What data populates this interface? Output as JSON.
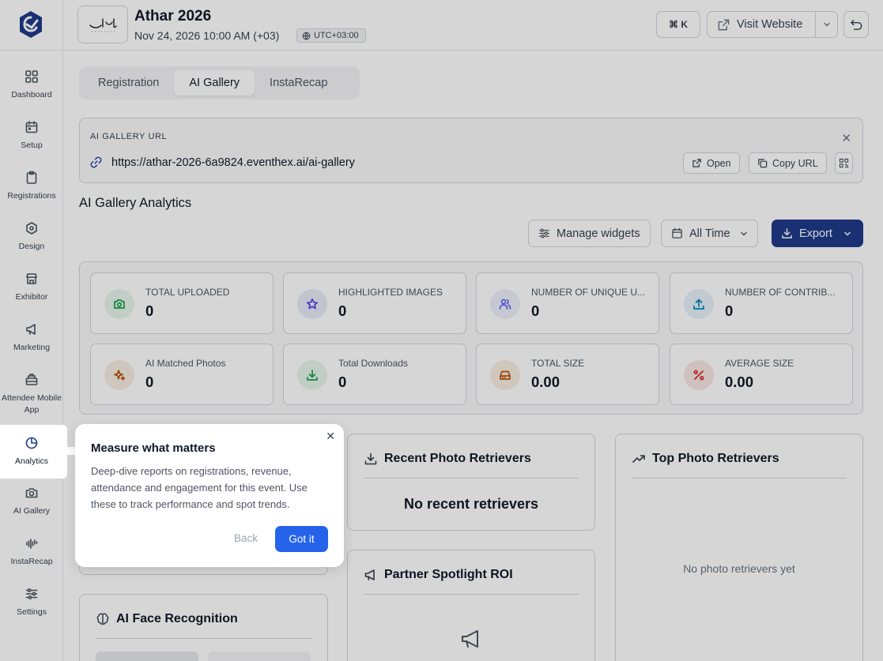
{
  "sidebar": {
    "items": [
      {
        "label": "Dashboard",
        "icon": "dashboard-icon"
      },
      {
        "label": "Setup",
        "icon": "calendar-icon"
      },
      {
        "label": "Registrations",
        "icon": "clipboard-icon"
      },
      {
        "label": "Design",
        "icon": "design-icon"
      },
      {
        "label": "Exhibitor",
        "icon": "store-icon"
      },
      {
        "label": "Marketing",
        "icon": "megaphone-icon"
      },
      {
        "label": "Attendee Mobile App",
        "icon": "mobile-app-icon"
      },
      {
        "label": "Analytics",
        "icon": "pie-chart-icon"
      },
      {
        "label": "AI Gallery",
        "icon": "camera-icon"
      },
      {
        "label": "InstaRecap",
        "icon": "audio-wave-icon"
      },
      {
        "label": "Settings",
        "icon": "sliders-icon"
      }
    ]
  },
  "header": {
    "event_title": "Athar 2026",
    "event_date": "Nov 24, 2026 10:00 AM (+03)",
    "timezone": "UTC+03:00",
    "shortcut": "⌘ K",
    "visit_website": "Visit Website"
  },
  "tabs": [
    "Registration",
    "AI Gallery",
    "InstaRecap"
  ],
  "url_card": {
    "label": "AI GALLERY URL",
    "url": "https://athar-2026-6a9824.eventhex.ai/ai-gallery",
    "open": "Open",
    "copy": "Copy URL"
  },
  "analytics": {
    "title": "AI Gallery Analytics",
    "manage_widgets": "Manage widgets",
    "time_range": "All Time",
    "export": "Export"
  },
  "stats": [
    {
      "label": "TOTAL UPLOADED",
      "value": "0",
      "icon": "camera-icon",
      "color": "#16a34a",
      "bg": "#e8f5ec"
    },
    {
      "label": "HIGHLIGHTED IMAGES",
      "value": "0",
      "icon": "star-icon",
      "color": "#4f46e5",
      "bg": "#e8eaf7"
    },
    {
      "label": "NUMBER OF UNIQUE U...",
      "value": "0",
      "icon": "users-icon",
      "color": "#6366f1",
      "bg": "#eef0fb"
    },
    {
      "label": "NUMBER OF CONTRIB...",
      "value": "0",
      "icon": "upload-icon",
      "color": "#0284c7",
      "bg": "#e6f1f8"
    },
    {
      "label": "AI Matched Photos",
      "value": "0",
      "icon": "sparkles-icon",
      "color": "#b45309",
      "bg": "#f7ede2"
    },
    {
      "label": "Total Downloads",
      "value": "0",
      "icon": "download-icon",
      "color": "#16a34a",
      "bg": "#e8f5ec"
    },
    {
      "label": "TOTAL SIZE",
      "value": "0.00",
      "icon": "hard-drive-icon",
      "color": "#b45309",
      "bg": "#f7ede2"
    },
    {
      "label": "AVERAGE SIZE",
      "value": "0.00",
      "icon": "percent-icon",
      "color": "#dc2626",
      "bg": "#f8e6e6"
    }
  ],
  "cards": {
    "recent": {
      "title": "Recent Photo Retrievers",
      "empty": "No recent retrievers"
    },
    "top": {
      "title": "Top Photo Retrievers",
      "empty": "No photo retrievers yet"
    },
    "partner": {
      "title": "Partner Spotlight ROI"
    },
    "face": {
      "title": "AI Face Recognition"
    }
  },
  "tour": {
    "title": "Measure what matters",
    "body": "Deep-dive reports on registrations, revenue, attendance and engagement for this event. Use these to track performance and spot trends.",
    "back": "Back",
    "got_it": "Got it"
  },
  "colors": {
    "primary": "#1e3a8a",
    "accent": "#2563eb"
  }
}
